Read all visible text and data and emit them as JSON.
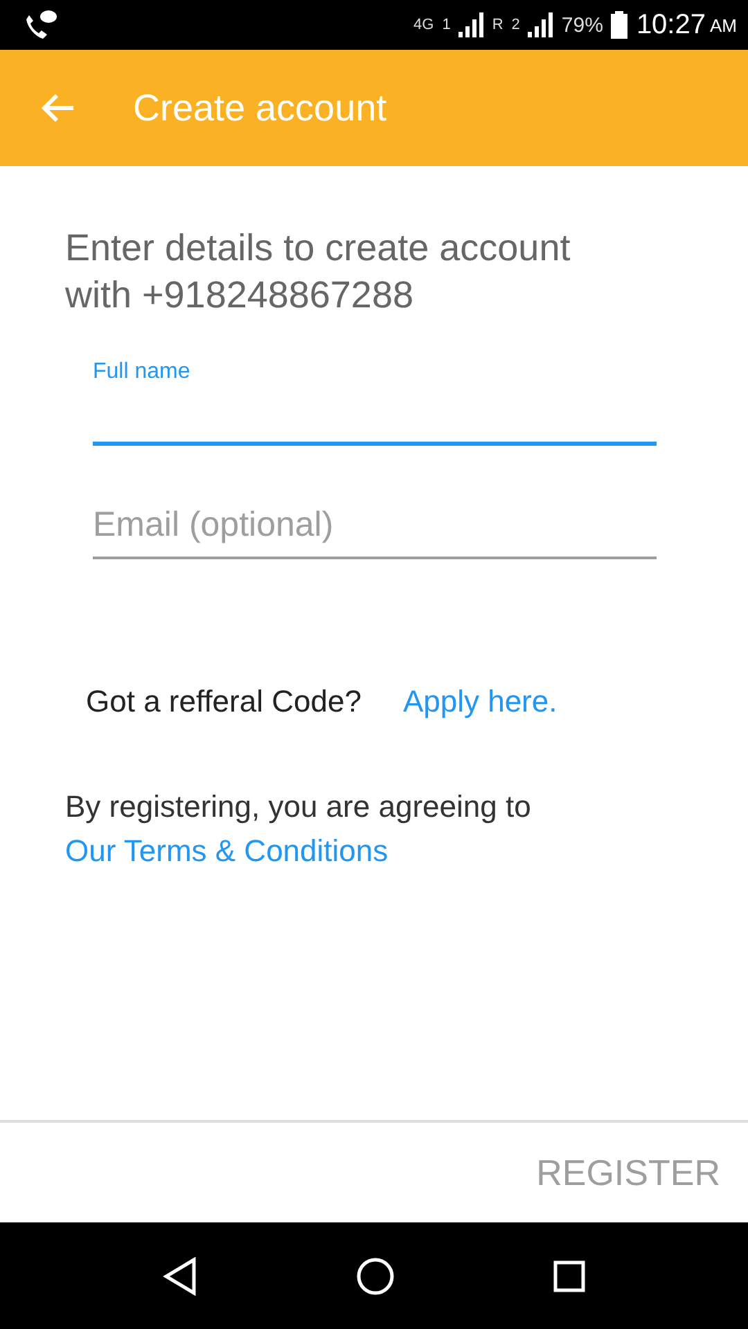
{
  "status_bar": {
    "network": "4G",
    "sim_1": "1",
    "roaming": "R",
    "sim_2": "2",
    "battery": "79%",
    "time": "10:27",
    "meridiem": "AM"
  },
  "app_bar": {
    "title": "Create account"
  },
  "intro": "Enter details to create account with  +918248867288",
  "fields": [
    {
      "label": "Full name",
      "focused": true
    },
    {
      "placeholder": "Email (optional)",
      "focused": false
    }
  ],
  "referral": {
    "question": "Got a refferal Code?",
    "link": "Apply here."
  },
  "terms": {
    "text": "By registering, you are agreeing to",
    "link": "Our Terms & Conditions"
  },
  "register_button": {
    "label": "REGISTER",
    "disabled": true
  }
}
